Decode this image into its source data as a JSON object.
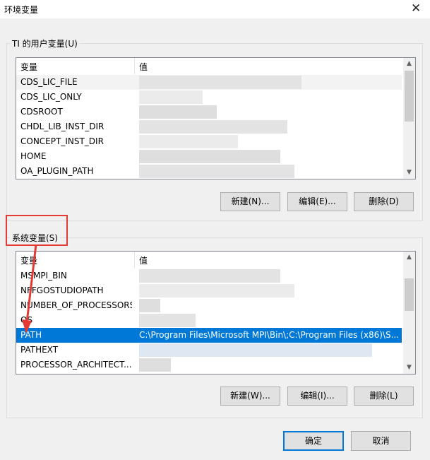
{
  "window": {
    "title": "环境变量",
    "close_glyph": "✕"
  },
  "user_vars": {
    "group_label": "TI 的用户变量(U)",
    "columns": [
      "变量",
      "值"
    ],
    "rows": [
      {
        "name": "CDS_LIC_FILE",
        "value": ""
      },
      {
        "name": "CDS_LIC_ONLY",
        "value": ""
      },
      {
        "name": "CDSROOT",
        "value": ""
      },
      {
        "name": "CHDL_LIB_INST_DIR",
        "value": ""
      },
      {
        "name": "CONCEPT_INST_DIR",
        "value": ""
      },
      {
        "name": "HOME",
        "value": ""
      },
      {
        "name": "OA_PLUGIN_PATH",
        "value": ""
      }
    ],
    "buttons": {
      "new": "新建(N)...",
      "edit": "编辑(E)...",
      "delete": "删除(D)"
    }
  },
  "system_vars": {
    "group_label": "系统变量(S)",
    "columns": [
      "变量",
      "值"
    ],
    "rows": [
      {
        "name": "MSMPI_BIN",
        "value": ""
      },
      {
        "name": "NFFGOSTUDIOPATH",
        "value": ""
      },
      {
        "name": "NUMBER_OF_PROCESSORS",
        "value": ""
      },
      {
        "name": "OS",
        "value": ""
      },
      {
        "name": "PATH",
        "value": "C:\\Program Files\\Microsoft MPI\\Bin\\;C:\\Program Files (x86)\\S..."
      },
      {
        "name": "PATHEXT",
        "value": ""
      },
      {
        "name": "PROCESSOR_ARCHITECT...",
        "value": ""
      }
    ],
    "buttons": {
      "new": "新建(W)...",
      "edit": "编辑(I)...",
      "delete": "删除(L)"
    }
  },
  "footer": {
    "ok": "确定",
    "cancel": "取消"
  },
  "colors": {
    "selection": "#0078d7",
    "annotation": "#e53935",
    "window_bg": "#f0f0f0"
  }
}
